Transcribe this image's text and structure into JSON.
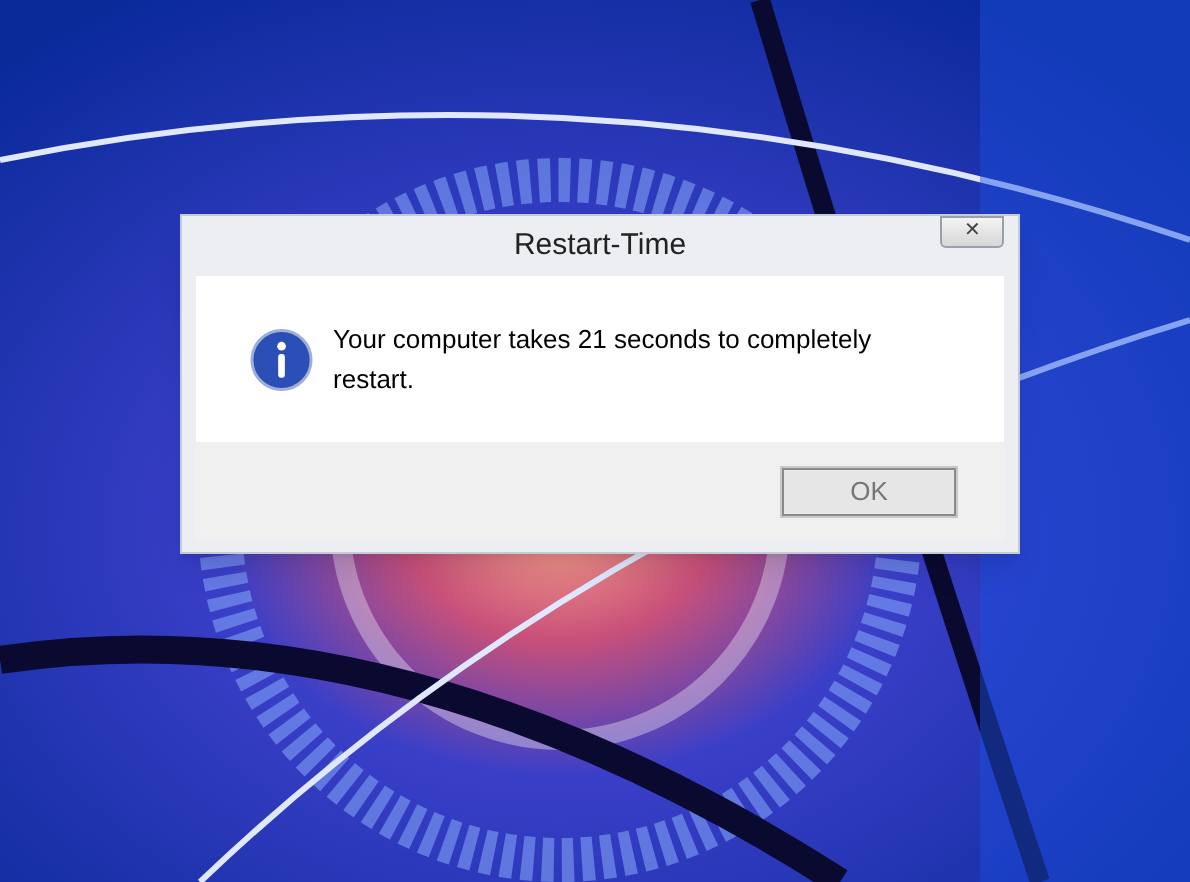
{
  "dialog": {
    "title": "Restart-Time",
    "close_glyph": "✕",
    "message": "Your computer takes 21 seconds to completely restart.",
    "buttons": [
      {
        "label": "OK"
      }
    ]
  }
}
